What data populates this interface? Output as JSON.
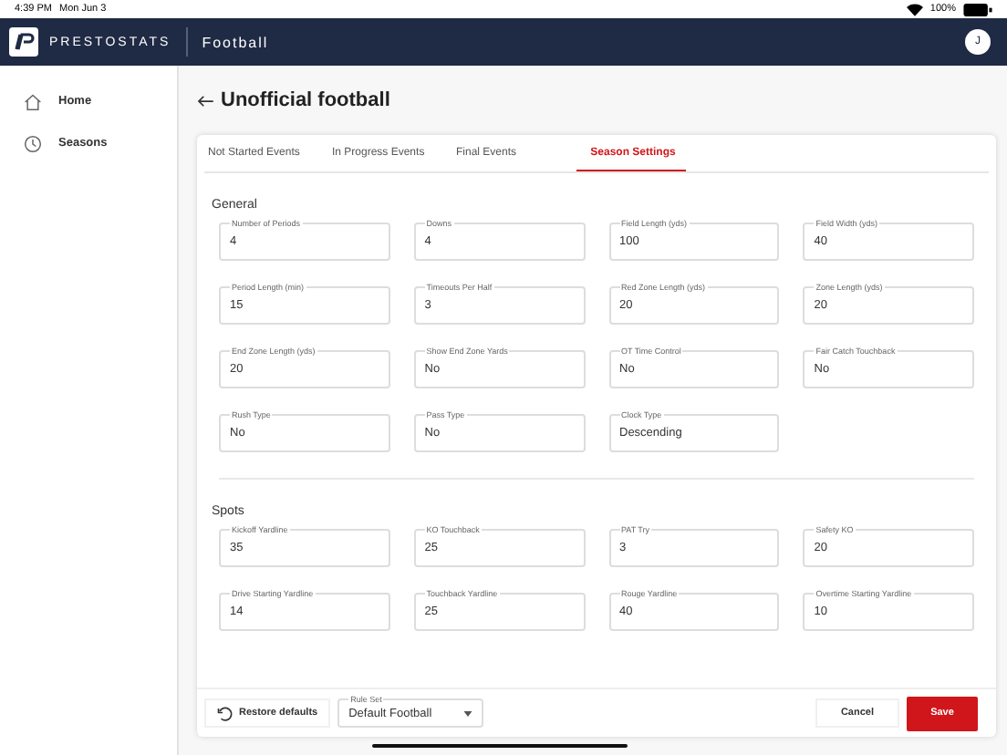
{
  "status_bar": {
    "time": "4:39 PM",
    "date": "Mon Jun 3",
    "battery": "100%"
  },
  "header": {
    "brand": "PRESTOSTATS",
    "sport": "Football",
    "avatar": "J"
  },
  "sidebar": {
    "items": [
      {
        "label": "Home"
      },
      {
        "label": "Seasons"
      }
    ]
  },
  "page": {
    "title": "Unofficial football"
  },
  "tabs": [
    {
      "label": "Not Started Events",
      "selected": false
    },
    {
      "label": "In Progress Events",
      "selected": false
    },
    {
      "label": "Final Events",
      "selected": false
    },
    {
      "label": "Season Settings",
      "selected": true
    }
  ],
  "sections": [
    {
      "title": "General",
      "fields": [
        {
          "label": "Number of Periods",
          "value": "4"
        },
        {
          "label": "Downs",
          "value": "4"
        },
        {
          "label": "Field Length (yds)",
          "value": "100"
        },
        {
          "label": "Field Width (yds)",
          "value": "40"
        },
        {
          "label": "Period Length (min)",
          "value": "15"
        },
        {
          "label": "Timeouts Per Half",
          "value": "3"
        },
        {
          "label": "Red Zone Length (yds)",
          "value": "20"
        },
        {
          "label": "Zone Length (yds)",
          "value": "20"
        },
        {
          "label": "End Zone Length (yds)",
          "value": "20"
        },
        {
          "label": "Show End Zone Yards",
          "value": "No"
        },
        {
          "label": "OT Time Control",
          "value": "No"
        },
        {
          "label": "Fair Catch Touchback",
          "value": "No"
        },
        {
          "label": "Rush Type",
          "value": "No"
        },
        {
          "label": "Pass Type",
          "value": "No"
        },
        {
          "label": "Clock Type",
          "value": "Descending"
        }
      ]
    },
    {
      "title": "Spots",
      "fields": [
        {
          "label": "Kickoff Yardline",
          "value": "35"
        },
        {
          "label": "KO Touchback",
          "value": "25"
        },
        {
          "label": "PAT Try",
          "value": "3"
        },
        {
          "label": "Safety KO",
          "value": "20"
        },
        {
          "label": "Drive Starting Yardline",
          "value": "14"
        },
        {
          "label": "Touchback Yardline",
          "value": "25"
        },
        {
          "label": "Rouge Yardline",
          "value": "40"
        },
        {
          "label": "Overtime Starting Yardline",
          "value": "10"
        }
      ]
    }
  ],
  "footer": {
    "restore": "Restore defaults",
    "rule_set": {
      "label": "Rule Set",
      "value": "Default Football"
    },
    "cancel": "Cancel",
    "save": "Save"
  }
}
